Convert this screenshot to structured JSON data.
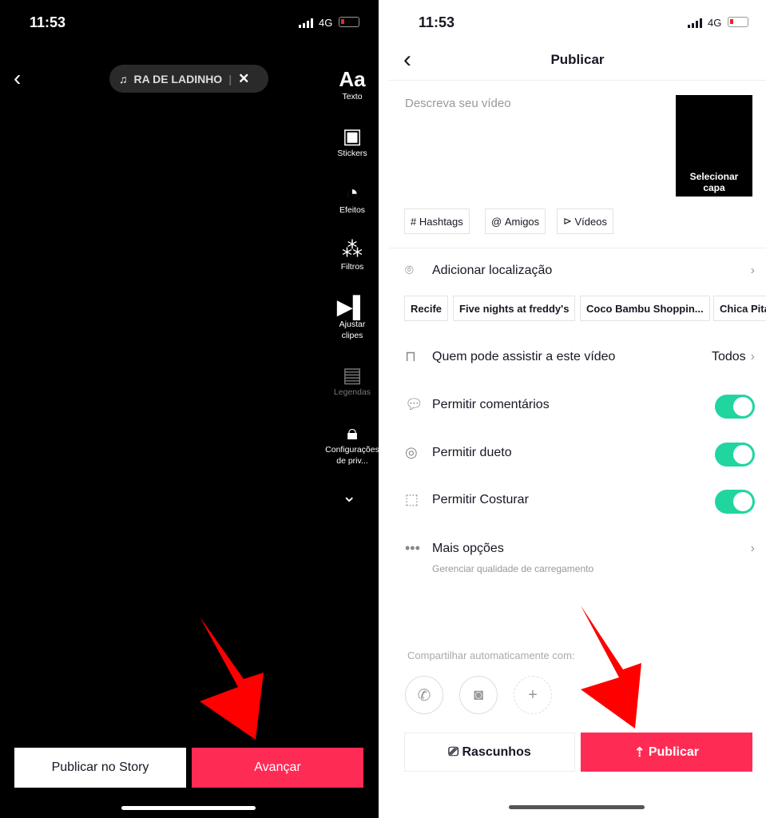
{
  "left": {
    "status": {
      "time": "11:53",
      "network": "4G"
    },
    "music": {
      "title": "RA DE LADINHO"
    },
    "tools": [
      {
        "label": "Texto",
        "icon": "text-icon"
      },
      {
        "label": "Stickers",
        "icon": "sticker-icon"
      },
      {
        "label": "Efeitos",
        "icon": "effects-icon"
      },
      {
        "label": "Filtros",
        "icon": "filters-icon"
      },
      {
        "label": "Ajustar clipes",
        "icon": "clip-icon"
      },
      {
        "label": "Legendas",
        "icon": "captions-icon"
      },
      {
        "label": "Configurações de priv...",
        "icon": "lock-icon"
      }
    ],
    "story_button": "Publicar no Story",
    "next_button": "Avançar"
  },
  "right": {
    "status": {
      "time": "11:53",
      "network": "4G"
    },
    "title": "Publicar",
    "description_placeholder": "Descreva seu vídeo",
    "cover_label": "Selecionar capa",
    "tags": [
      "Hashtags",
      "Amigos",
      "Vídeos"
    ],
    "location_label": "Adicionar localização",
    "locations": [
      "Recife",
      "Five nights at freddy's",
      "Coco Bambu Shoppin...",
      "Chica Pita"
    ],
    "privacy": {
      "label": "Quem pode assistir a este vídeo",
      "value": "Todos"
    },
    "toggles": [
      {
        "label": "Permitir comentários",
        "on": true
      },
      {
        "label": "Permitir dueto",
        "on": true
      },
      {
        "label": "Permitir Costurar",
        "on": true
      }
    ],
    "more": {
      "label": "Mais opções",
      "sub": "Gerenciar qualidade de carregamento"
    },
    "share_label": "Compartilhar automaticamente com:",
    "drafts_button": "Rascunhos",
    "publish_button": "Publicar"
  },
  "colors": {
    "accent": "#fe2c55",
    "toggle": "#20d5a0",
    "arrow": "#ff0000"
  }
}
